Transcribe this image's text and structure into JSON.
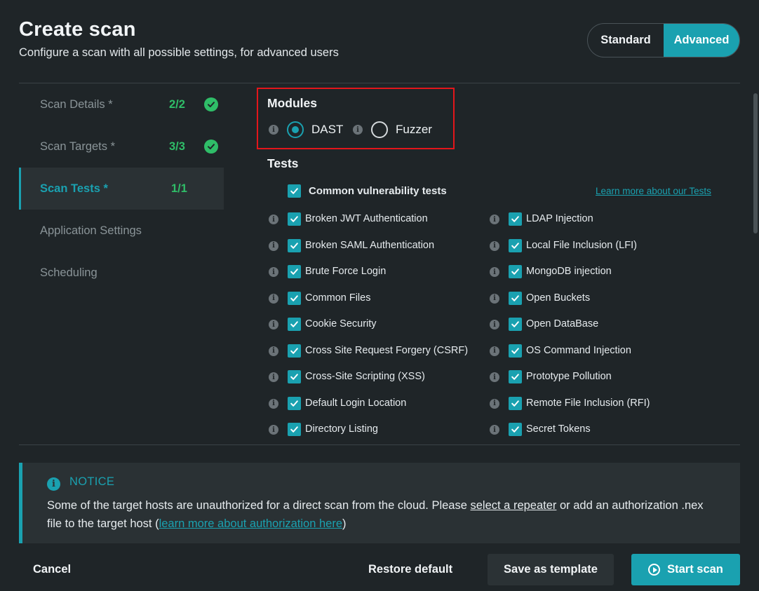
{
  "header": {
    "title": "Create scan",
    "subtitle": "Configure a scan with all possible settings, for advanced users"
  },
  "mode_toggle": {
    "standard_label": "Standard",
    "advanced_label": "Advanced",
    "selected": "Advanced"
  },
  "steps": [
    {
      "label": "Scan Details *",
      "count": "2/2",
      "complete": true
    },
    {
      "label": "Scan Targets *",
      "count": "3/3",
      "complete": true
    },
    {
      "label": "Scan Tests *",
      "count": "1/1",
      "complete": false,
      "active": true
    },
    {
      "label": "Application Settings",
      "count": ""
    },
    {
      "label": "Scheduling",
      "count": ""
    }
  ],
  "modules": {
    "title": "Modules",
    "options": [
      {
        "label": "DAST",
        "selected": true
      },
      {
        "label": "Fuzzer",
        "selected": false
      }
    ]
  },
  "tests": {
    "title": "Tests",
    "group_label": "Common vulnerability tests",
    "learn_more": "Learn more about our Tests",
    "left": [
      "Broken JWT Authentication",
      "Broken SAML Authentication",
      "Brute Force Login",
      "Common Files",
      "Cookie Security",
      "Cross Site Request Forgery (CSRF)",
      "Cross-Site Scripting (XSS)",
      "Default Login Location",
      "Directory Listing"
    ],
    "right": [
      "LDAP Injection",
      "Local File Inclusion (LFI)",
      "MongoDB injection",
      "Open Buckets",
      "Open DataBase",
      "OS Command Injection",
      "Prototype Pollution",
      "Remote File Inclusion (RFI)",
      "Secret Tokens"
    ]
  },
  "notice": {
    "title": "NOTICE",
    "text_1": "Some of the target hosts are unauthorized for a direct scan from the cloud. Please ",
    "link_1": "select a repeater",
    "text_2": " or add an authorization .nex file to the target host (",
    "link_2": "learn more about authorization here",
    "text_3": ")"
  },
  "footer": {
    "cancel": "Cancel",
    "restore": "Restore default",
    "save_template": "Save as template",
    "start": "Start scan"
  },
  "colors": {
    "accent": "#1aa1b0",
    "success": "#2fbd68",
    "highlight": "#e3161b",
    "background": "#1f2528"
  }
}
